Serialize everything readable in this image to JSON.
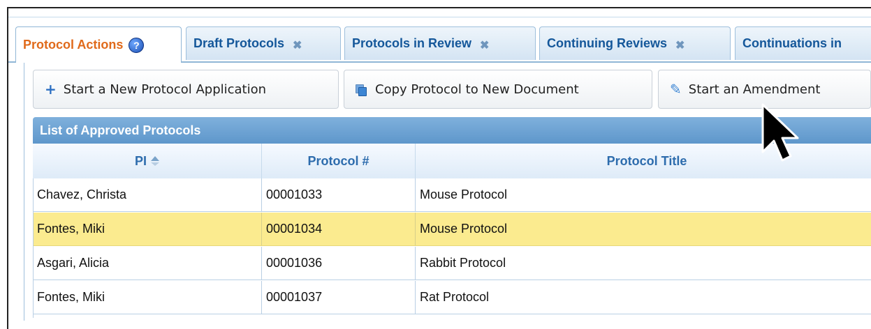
{
  "tabs": [
    {
      "label": "Protocol Actions",
      "active": true,
      "has_help": true
    },
    {
      "label": "Draft Protocols",
      "closable": true
    },
    {
      "label": "Protocols in Review",
      "closable": true
    },
    {
      "label": "Continuing Reviews",
      "closable": true
    },
    {
      "label": "Continuations in",
      "closable": false
    }
  ],
  "help_glyph": "?",
  "close_glyph": "✖",
  "actions": {
    "new_protocol": "Start a New Protocol Application",
    "copy_protocol": "Copy Protocol to New Document",
    "amendment": "Start an Amendment"
  },
  "icons": {
    "plus": "+",
    "pencil": "✎"
  },
  "grid": {
    "title": "List of Approved Protocols",
    "columns": [
      "PI",
      "Protocol #",
      "Protocol Title"
    ],
    "sort_column": "PI",
    "rows": [
      {
        "pi": "Chavez, Christa",
        "number": "00001033",
        "title": "Mouse Protocol",
        "selected": false
      },
      {
        "pi": "Fontes, Miki",
        "number": "00001034",
        "title": "Mouse Protocol",
        "selected": true
      },
      {
        "pi": "Asgari, Alicia",
        "number": "00001036",
        "title": "Rabbit Protocol",
        "selected": false
      },
      {
        "pi": "Fontes, Miki",
        "number": "00001037",
        "title": "Rat Protocol",
        "selected": false
      }
    ]
  },
  "colors": {
    "active_tab_text": "#e06a1b",
    "tab_text": "#14579a",
    "selected_row": "#fbeb8f",
    "grid_header": "#5e97cb"
  }
}
